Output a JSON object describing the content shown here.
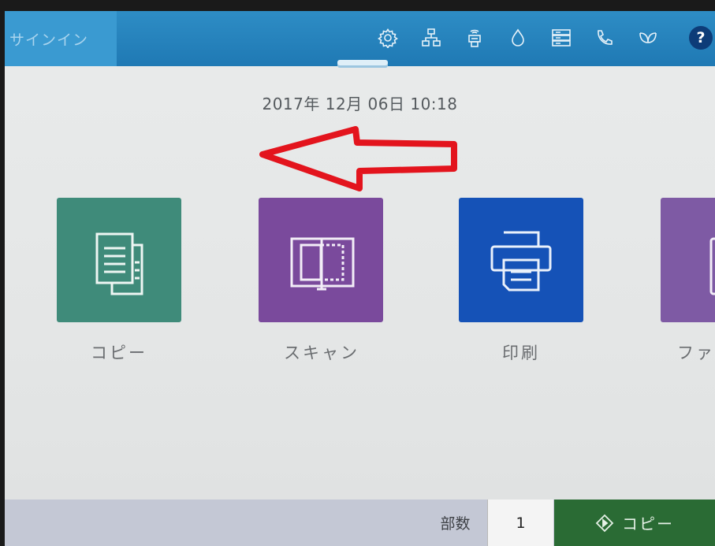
{
  "header": {
    "signin_label": "サインイン",
    "status_icons": [
      "gear-icon",
      "network-icon",
      "wireless-direct-icon",
      "ink-drop-icon",
      "tray-icon",
      "phone-icon",
      "leaf-icon",
      "help-icon"
    ],
    "help_label": "?"
  },
  "datetime": "2017年 12月 06日 10:18",
  "apps": [
    {
      "label": "コピー",
      "icon": "copy-icon",
      "color": "#3f8b7a"
    },
    {
      "label": "スキャン",
      "icon": "scan-icon",
      "color": "#7a4a9c"
    },
    {
      "label": "印刷",
      "icon": "print-icon",
      "color": "#1552b7"
    },
    {
      "label": "ファ",
      "icon": "fax-icon",
      "color": "#7e5aa4"
    }
  ],
  "footer": {
    "copies_label": "部数",
    "copies_value": "1",
    "start_label": "コピー"
  },
  "colors": {
    "topbar": "#2a86c0",
    "annotation_arrow": "#e3141d",
    "copy_button": "#2a6b34"
  }
}
